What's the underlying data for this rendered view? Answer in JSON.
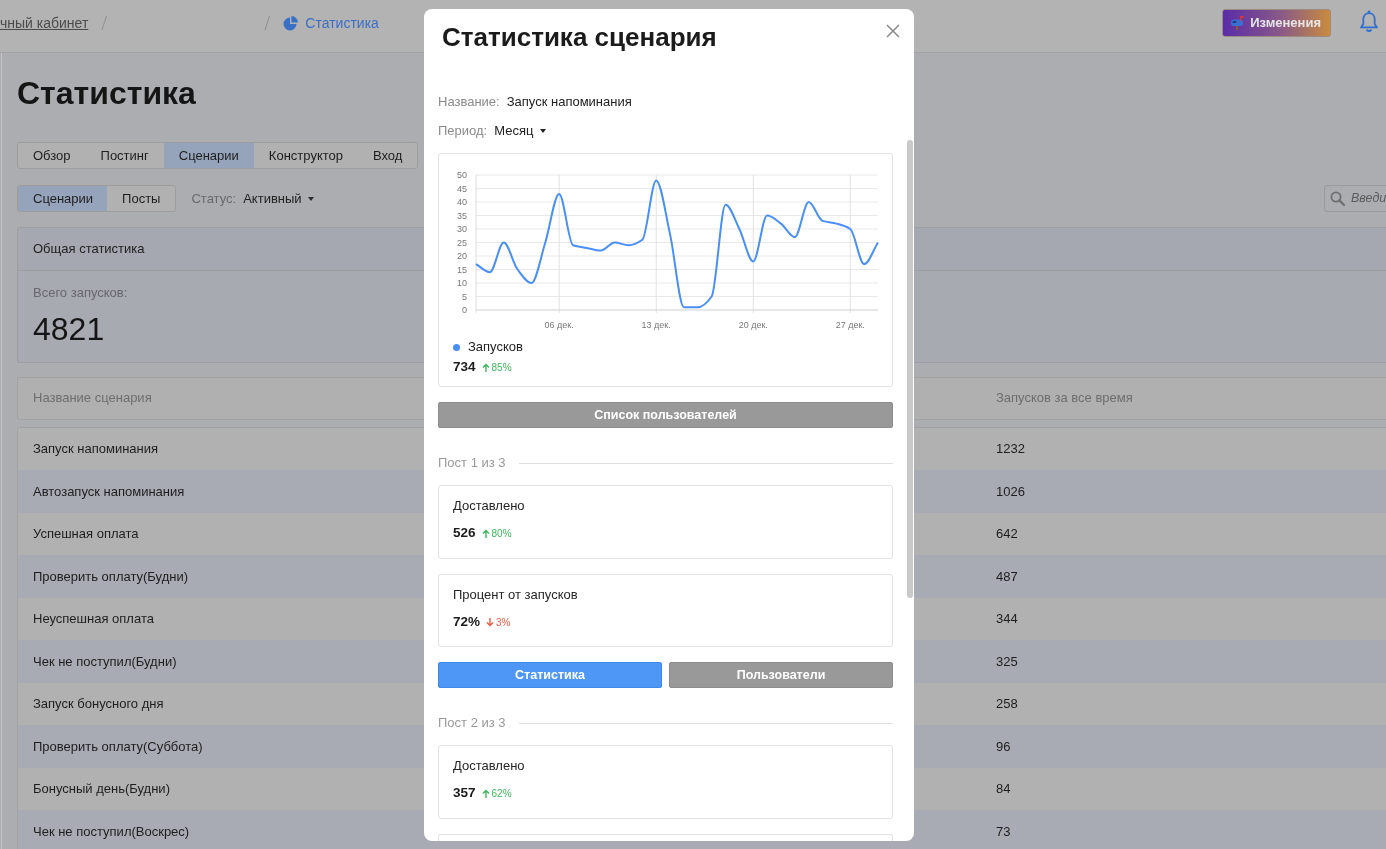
{
  "header": {
    "breadcrumbs": [
      {
        "label": "чный кабинет",
        "kind": "link"
      },
      {
        "label": "Статистика",
        "kind": "current"
      }
    ],
    "changes_button": "Изменения"
  },
  "page": {
    "title": "Статистика",
    "tabs": [
      {
        "label": "Обзор",
        "selected": false
      },
      {
        "label": "Постинг",
        "selected": false
      },
      {
        "label": "Сценарии",
        "selected": true
      },
      {
        "label": "Конструктор",
        "selected": false
      },
      {
        "label": "Вход",
        "selected": false
      }
    ],
    "subtabs": [
      {
        "label": "Сценарии",
        "selected": true
      },
      {
        "label": "Посты",
        "selected": false
      }
    ],
    "status_filter": {
      "label": "Статус:",
      "value": "Активный",
      "kind": "dropdown"
    },
    "search": {
      "placeholder": "Введи"
    }
  },
  "summary_card": {
    "title": "Общая статистика",
    "label": "Всего запусков:",
    "value": "4821"
  },
  "table": {
    "columns": [
      "Название сценария",
      "Запусков за все время"
    ],
    "rows": [
      [
        "Запуск напоминания",
        "1232"
      ],
      [
        "Автозапуск напоминания",
        "1026"
      ],
      [
        "Успешная оплата",
        "642"
      ],
      [
        "Проверить оплату(Будни)",
        "487"
      ],
      [
        "Неуспешная оплата",
        "344"
      ],
      [
        "Чек не поступил(Будни)",
        "325"
      ],
      [
        "Запуск бонусного дня",
        "258"
      ],
      [
        "Проверить оплату(Суббота)",
        "96"
      ],
      [
        "Бонусный день(Будни)",
        "84"
      ],
      [
        "Чек не поступил(Воскрес)",
        "73"
      ]
    ]
  },
  "modal": {
    "title": "Статистика сценария",
    "fields": [
      {
        "label": "Название:",
        "value": "Запуск напоминания",
        "kind": "text"
      },
      {
        "label": "Период:",
        "value": "Месяц",
        "kind": "dropdown"
      }
    ],
    "chart_card": {
      "chart_data": {
        "type": "line",
        "grid": true,
        "x": [
          0,
          1,
          2,
          3,
          4,
          5,
          6,
          7,
          8,
          9,
          10,
          11,
          12,
          13,
          14,
          15,
          16,
          17,
          18,
          19,
          20,
          21,
          22,
          23,
          24,
          25,
          26,
          27,
          28,
          29
        ],
        "xlim": [
          0,
          29
        ],
        "ylim": [
          0,
          50
        ],
        "xticks": [
          {
            "value": 6,
            "label": "06 дек."
          },
          {
            "value": 13,
            "label": "13 дек."
          },
          {
            "value": 20,
            "label": "20 дек."
          },
          {
            "value": 27,
            "label": "27 дек."
          }
        ],
        "yticks": [
          0,
          5,
          10,
          15,
          20,
          25,
          30,
          35,
          40,
          45,
          50
        ],
        "series": [
          {
            "name": "Запусков",
            "color": "#4a8ff5",
            "values": [
              17,
              14,
              25,
              15,
              10,
              25,
              43,
              24,
              23,
              22,
              25,
              24,
              26,
              48,
              28,
              1,
              1,
              5,
              39,
              30,
              18,
              35,
              32,
              27,
              40,
              33,
              32,
              30,
              17,
              25
            ]
          }
        ]
      },
      "total": "734",
      "rising": true,
      "change": "85%"
    },
    "users_button": {
      "label": "Список пользователей",
      "kind": "secondary"
    },
    "posts": [
      {
        "title": "Пост 1 из 3",
        "stats": [
          {
            "label": "Доставлено",
            "value": "526",
            "rising": true,
            "change": "80%"
          },
          {
            "label": "Процент от запусков",
            "value": "72%",
            "rising": false,
            "change": "3%"
          }
        ],
        "buttons": [
          {
            "label": "Статистика",
            "kind": "primary"
          },
          {
            "label": "Пользователи",
            "kind": "secondary"
          }
        ],
        "continues": false
      },
      {
        "title": "Пост 2 из 3",
        "stats": [
          {
            "label": "Доставлено",
            "value": "357",
            "rising": true,
            "change": "62%"
          }
        ],
        "continues": true
      }
    ]
  }
}
